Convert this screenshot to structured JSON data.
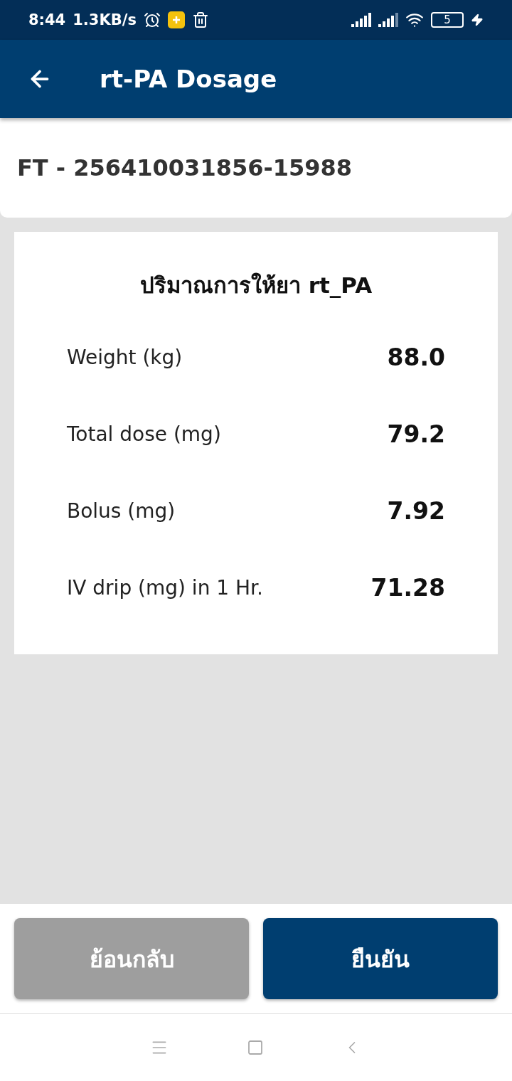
{
  "status_bar": {
    "time": "8:44",
    "speed": "1.3KB/s",
    "battery": "5"
  },
  "app_bar": {
    "title": "rt-PA Dosage"
  },
  "header": {
    "code": "FT - 256410031856-15988"
  },
  "card": {
    "title": "ปริมาณการให้ยา rt_PA",
    "rows": [
      {
        "label": "Weight (kg)",
        "value": "88.0"
      },
      {
        "label": "Total dose (mg)",
        "value": "79.2"
      },
      {
        "label": "Bolus (mg)",
        "value": "7.92"
      },
      {
        "label": "IV drip (mg) in 1 Hr.",
        "value": "71.28"
      }
    ]
  },
  "buttons": [
    {
      "label": "ย้อนกลับ",
      "kind": "secondary"
    },
    {
      "label": "ยืนยัน",
      "kind": "primary"
    }
  ]
}
